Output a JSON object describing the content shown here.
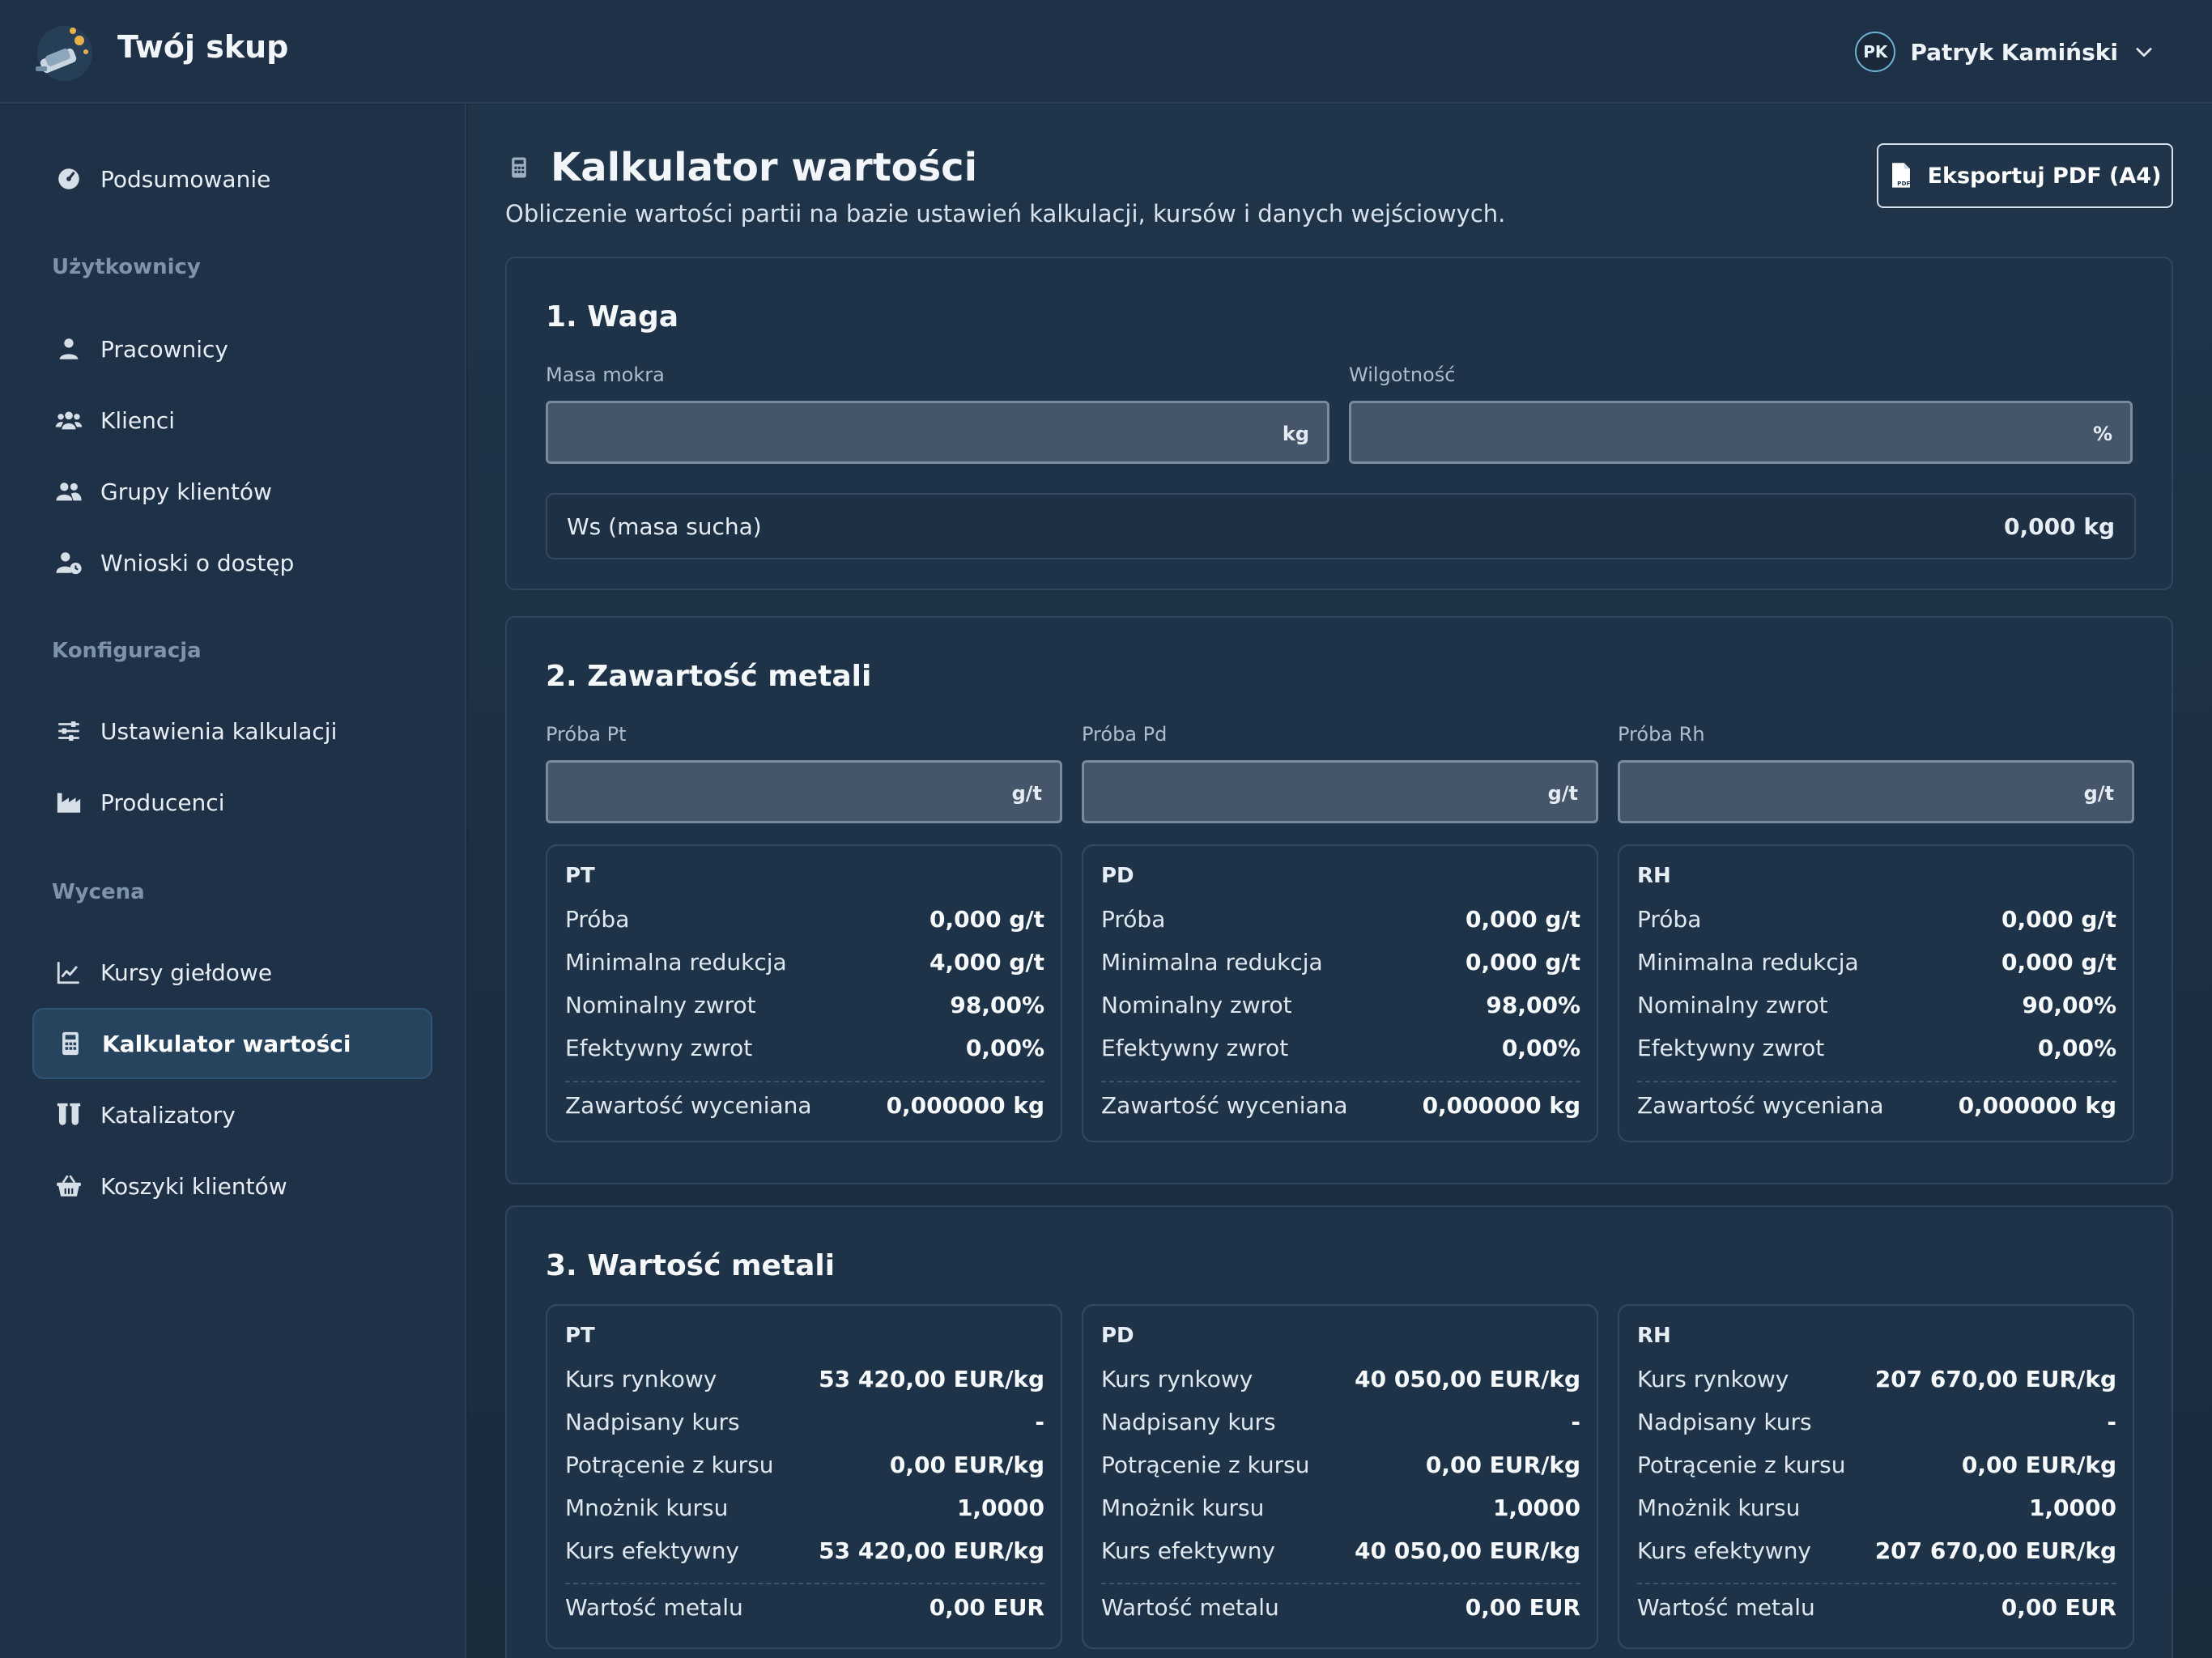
{
  "app": {
    "title": "Twój skup"
  },
  "user": {
    "initials": "PK",
    "name": "Patryk Kamiński"
  },
  "sidebar": {
    "summary": {
      "label": "Podsumowanie",
      "icon": "gauge-icon"
    },
    "sections": [
      {
        "title": "Użytkownicy"
      },
      {
        "title": "Konfiguracja"
      },
      {
        "title": "Wycena"
      }
    ],
    "items": [
      {
        "label": "Pracownicy",
        "icon": "user-icon"
      },
      {
        "label": "Klienci",
        "icon": "users-icon"
      },
      {
        "label": "Grupy klientów",
        "icon": "user-group-icon"
      },
      {
        "label": "Wnioski o dostęp",
        "icon": "user-clock-icon"
      },
      {
        "label": "Ustawienia kalkulacji",
        "icon": "sliders-icon"
      },
      {
        "label": "Producenci",
        "icon": "factory-icon"
      },
      {
        "label": "Kursy giełdowe",
        "icon": "chart-line-icon"
      },
      {
        "label": "Kalkulator wartości",
        "icon": "calculator-icon",
        "active": true
      },
      {
        "label": "Katalizatory",
        "icon": "flask-icon"
      },
      {
        "label": "Koszyki klientów",
        "icon": "basket-icon"
      }
    ]
  },
  "page": {
    "title": "Kalkulator wartości",
    "subtitle": "Obliczenie wartości partii na bazie ustawień kalkulacji, kursów i danych wejściowych.",
    "export_label": "Eksportuj PDF (A4)"
  },
  "weight": {
    "title": "1. Waga",
    "wet_label": "Masa mokra",
    "wet_value": "",
    "wet_unit": "kg",
    "moist_label": "Wilgotność",
    "moist_value": "",
    "moist_unit": "%",
    "dry_label": "Ws (masa sucha)",
    "dry_value": "0,000 kg"
  },
  "content": {
    "title": "2. Zawartość metali",
    "inputs": [
      {
        "label": "Próba Pt",
        "unit": "g/t",
        "value": ""
      },
      {
        "label": "Próba Pd",
        "unit": "g/t",
        "value": ""
      },
      {
        "label": "Próba Rh",
        "unit": "g/t",
        "value": ""
      }
    ],
    "row_labels": {
      "sample": "Próba",
      "min_reduction": "Minimalna redukcja",
      "nominal": "Nominalny zwrot",
      "effective": "Efektywny zwrot",
      "valued": "Zawartość wyceniana"
    },
    "metals": [
      {
        "name": "PT",
        "sample": "0,000 g/t",
        "min_reduction": "4,000 g/t",
        "nominal": "98,00%",
        "effective": "0,00%",
        "valued": "0,000000 kg"
      },
      {
        "name": "PD",
        "sample": "0,000 g/t",
        "min_reduction": "0,000 g/t",
        "nominal": "98,00%",
        "effective": "0,00%",
        "valued": "0,000000 kg"
      },
      {
        "name": "RH",
        "sample": "0,000 g/t",
        "min_reduction": "0,000 g/t",
        "nominal": "90,00%",
        "effective": "0,00%",
        "valued": "0,000000 kg"
      }
    ]
  },
  "value": {
    "title": "3. Wartość metali",
    "row_labels": {
      "market": "Kurs rynkowy",
      "override": "Nadpisany kurs",
      "deduction": "Potrącenie z kursu",
      "multiplier": "Mnożnik kursu",
      "effective": "Kurs efektywny",
      "metal_value": "Wartość metalu"
    },
    "metals": [
      {
        "name": "PT",
        "market": "53 420,00 EUR/kg",
        "override": "-",
        "deduction": "0,00 EUR/kg",
        "multiplier": "1,0000",
        "effective": "53 420,00 EUR/kg",
        "metal_value": "0,00 EUR"
      },
      {
        "name": "PD",
        "market": "40 050,00 EUR/kg",
        "override": "-",
        "deduction": "0,00 EUR/kg",
        "multiplier": "1,0000",
        "effective": "40 050,00 EUR/kg",
        "metal_value": "0,00 EUR"
      },
      {
        "name": "RH",
        "market": "207 670,00 EUR/kg",
        "override": "-",
        "deduction": "0,00 EUR/kg",
        "multiplier": "1,0000",
        "effective": "207 670,00 EUR/kg",
        "metal_value": "0,00 EUR"
      }
    ]
  }
}
